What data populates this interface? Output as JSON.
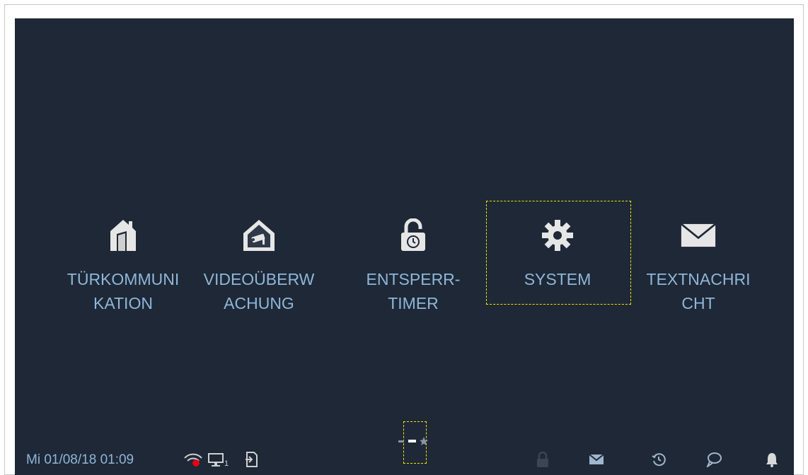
{
  "tiles": [
    {
      "line1": "TÜRKOMMUNI",
      "line2": "KATION",
      "icon": "house-door-icon"
    },
    {
      "line1": "VIDEOÜBERW",
      "line2": "ACHUNG",
      "icon": "house-camera-icon"
    },
    {
      "line1": "ENTSPERR-",
      "line2": "TIMER",
      "icon": "padlock-timer-icon"
    },
    {
      "line1": "SYSTEM",
      "line2": "",
      "icon": "gear-icon"
    },
    {
      "line1": "TEXTNACHRI",
      "line2": "CHT",
      "icon": "envelope-icon"
    }
  ],
  "status": {
    "datetime": "Mi 01/08/18  01:09",
    "monitor_subscript": "1"
  },
  "colors": {
    "background": "#1e2836",
    "label": "#8fb6d9",
    "highlight": "#f2e600",
    "icon": "#ffffff",
    "alert": "#e0001a"
  }
}
